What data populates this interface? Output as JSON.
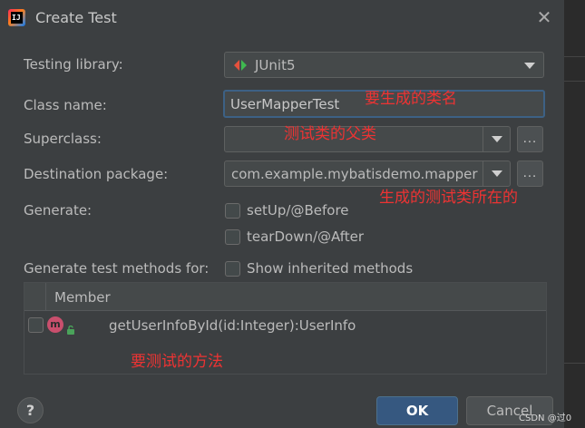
{
  "window": {
    "title": "Create Test",
    "app_icon_text": "IJ"
  },
  "form": {
    "testing_library": {
      "label": "Testing library:",
      "value": "JUnit5"
    },
    "class_name": {
      "label": "Class name:",
      "value": "UserMapperTest"
    },
    "superclass": {
      "label": "Superclass:",
      "value": ""
    },
    "destination_package": {
      "label": "Destination package:",
      "value": "com.example.mybatisdemo.mapper"
    },
    "generate": {
      "label": "Generate:",
      "options": [
        {
          "label": "setUp/@Before",
          "checked": false
        },
        {
          "label": "tearDown/@After",
          "checked": false
        }
      ]
    },
    "methods_for": {
      "label": "Generate test methods for:",
      "show_inherited_label": "Show inherited methods",
      "show_inherited_checked": false
    },
    "dots_label": "..."
  },
  "members_table": {
    "column_header": "Member",
    "rows": [
      {
        "icon_letter": "m",
        "signature": "getUserInfoById(id:Integer):UserInfo",
        "checked": false
      }
    ]
  },
  "annotations": {
    "class_name_note": "要生成的类名",
    "superclass_note": "测试类的父类",
    "package_note": "生成的测试类所在的",
    "method_note": "要测试的方法"
  },
  "buttons": {
    "help": "?",
    "ok": "OK",
    "cancel": "Cancel"
  },
  "watermark": "CSDN @过0",
  "colors": {
    "accent": "#365880",
    "annotation_red": "#ee3333",
    "focus_border": "#3d6185"
  }
}
